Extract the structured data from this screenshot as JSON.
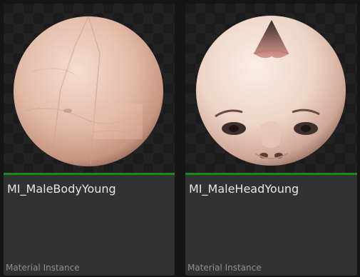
{
  "assets": [
    {
      "name": "MI_MaleBodyYoung",
      "type": "Material Instance",
      "thumbnail_icon": "material-sphere-skin-body-icon"
    },
    {
      "name": "MI_MaleHeadYoung",
      "type": "Material Instance",
      "thumbnail_icon": "material-sphere-face-icon"
    }
  ],
  "colors": {
    "type_bar": "#1a8a1a",
    "tile_background": "#323232",
    "name_text": "#e6e6e6",
    "type_text": "#8f8f8f"
  }
}
